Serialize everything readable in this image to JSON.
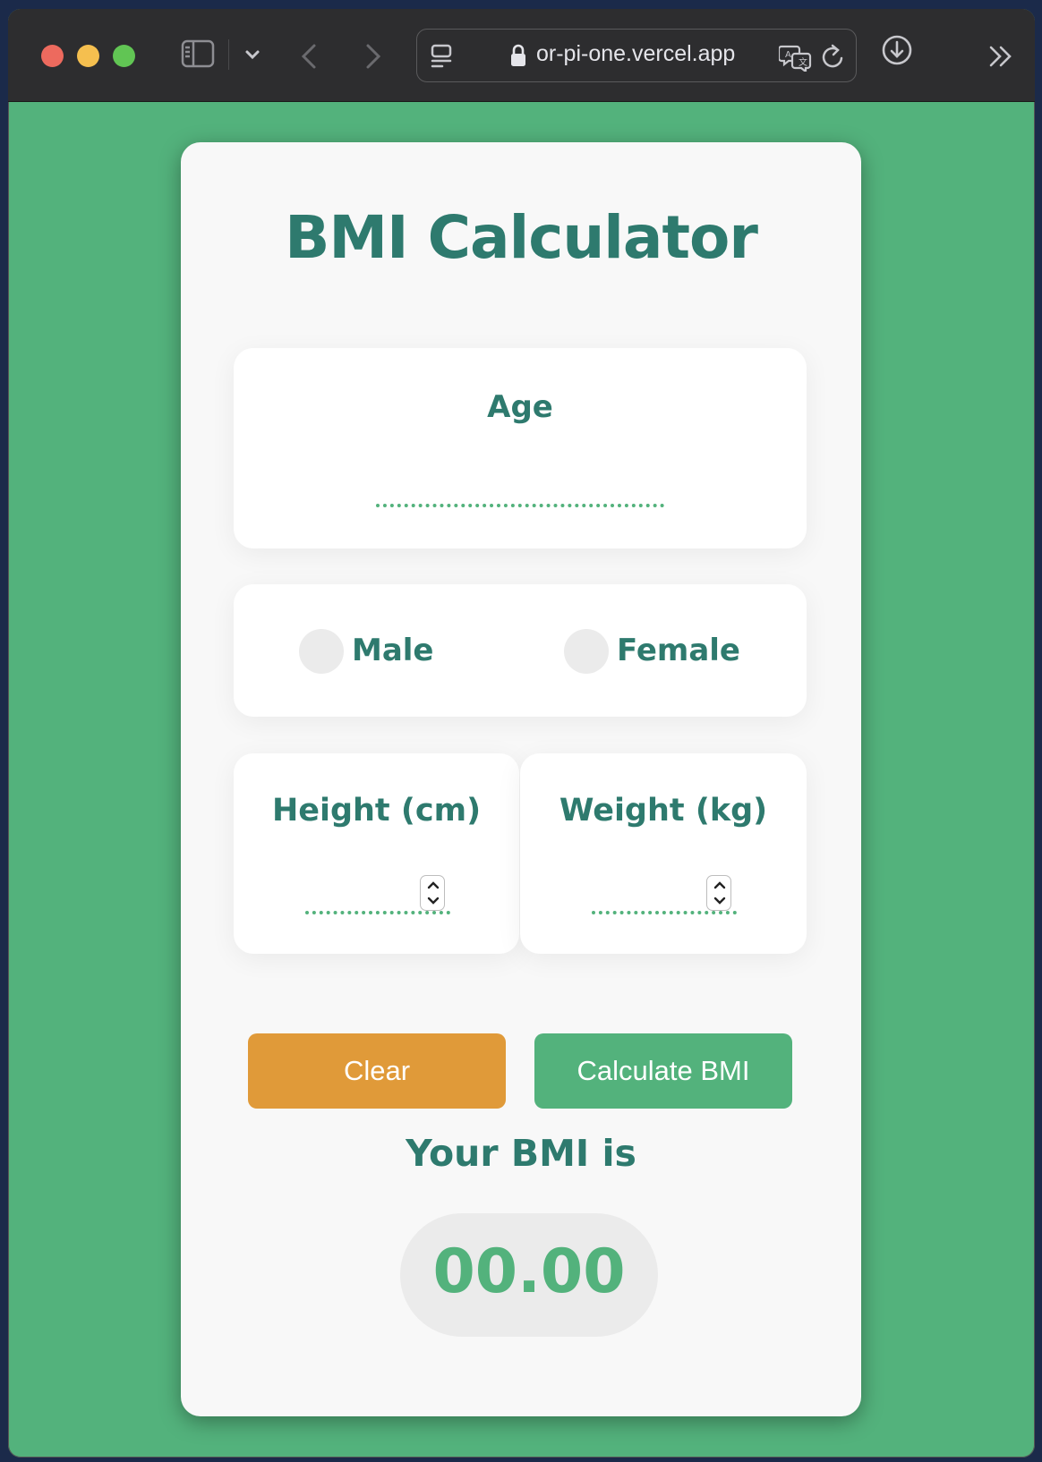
{
  "browser": {
    "url": "or-pi-one.vercel.app"
  },
  "app": {
    "title": "BMI Calculator",
    "age": {
      "label": "Age",
      "value": ""
    },
    "gender": {
      "options": [
        "Male",
        "Female"
      ]
    },
    "height": {
      "label": "Height (cm)",
      "value": ""
    },
    "weight": {
      "label": "Weight (kg)",
      "value": ""
    },
    "buttons": {
      "clear": "Clear",
      "calculate": "Calculate BMI"
    },
    "result": {
      "label": "Your BMI is",
      "value": "00.00"
    }
  },
  "colors": {
    "background": "#53b27c",
    "card": "#f8f8f8",
    "text_primary": "#2e7a6e",
    "accent_green": "#53b27c",
    "clear_button": "#e09a39",
    "result_pill": "#ebebeb"
  }
}
